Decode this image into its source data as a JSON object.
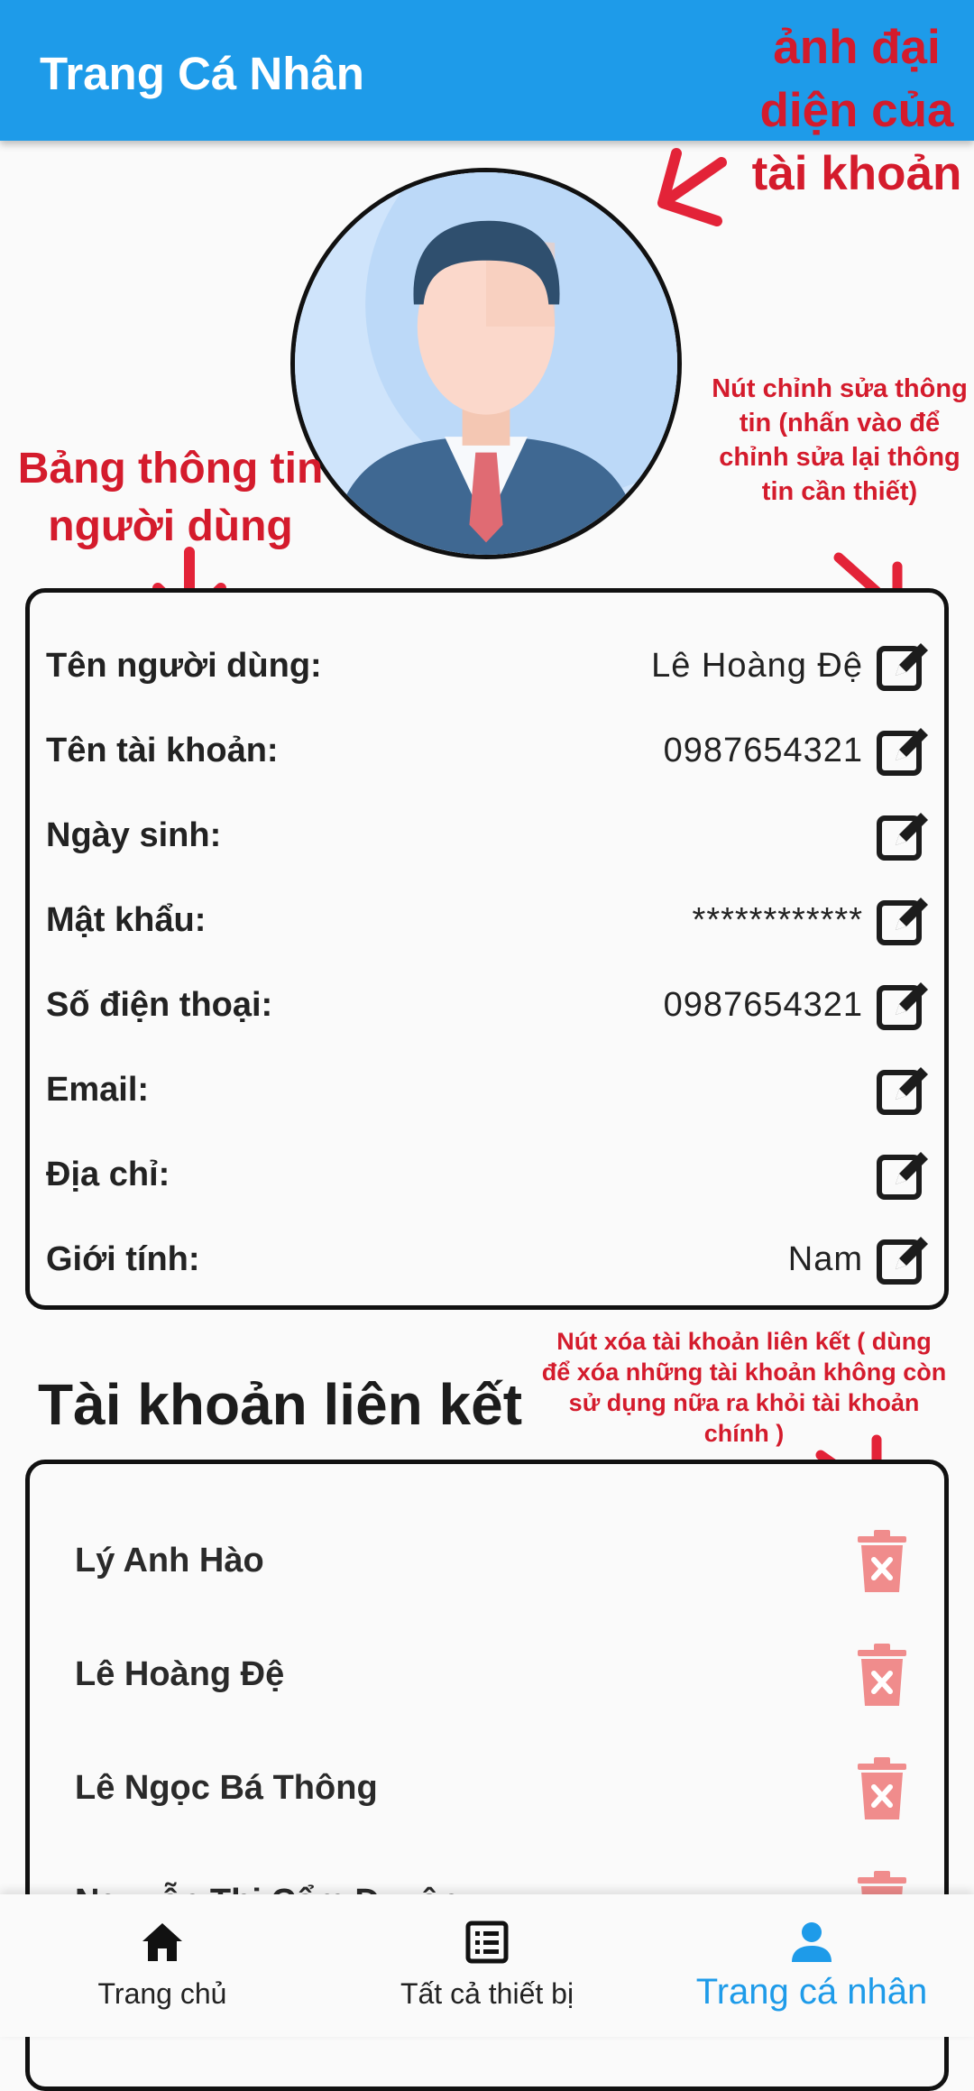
{
  "app_bar": {
    "title": "Trang Cá Nhân"
  },
  "annotations": {
    "avatar": "ảnh đại diện của tài khoản",
    "table": "Bảng thông tin người dùng",
    "edit": "Nút chỉnh sửa thông tin (nhấn vào để chỉnh sửa lại thông tin cần thiết)",
    "delete": "Nút xóa tài khoản liên kết ( dùng để xóa những tài khoản không còn sử dụng nữa ra khỏi tài khoản chính )"
  },
  "profile": {
    "fields": [
      {
        "label": "Tên người dùng:",
        "value": "Lê Hoàng Đệ"
      },
      {
        "label": "Tên tài khoản:",
        "value": "0987654321"
      },
      {
        "label": "Ngày sinh:",
        "value": ""
      },
      {
        "label": "Mật khẩu:",
        "value": "************"
      },
      {
        "label": "Số điện thoại:",
        "value": "0987654321"
      },
      {
        "label": "Email:",
        "value": ""
      },
      {
        "label": "Địa chỉ:",
        "value": ""
      },
      {
        "label": "Giới tính:",
        "value": "Nam"
      }
    ]
  },
  "linked": {
    "title": "Tài khoản liên kết",
    "accounts": [
      "Lý Anh Hào",
      "Lê Hoàng Đệ",
      "Lê Ngọc Bá Thông",
      "Nguyễn Thị Cẩm Duyên"
    ]
  },
  "bottom_nav": {
    "items": [
      {
        "label": "Trang chủ",
        "icon": "home-icon"
      },
      {
        "label": "Tất cả thiết bị",
        "icon": "list-icon"
      },
      {
        "label": "Trang cá nhân",
        "icon": "person-icon"
      }
    ],
    "active_index": 2
  },
  "colors": {
    "primary": "#1e9be9",
    "annotation": "#d41b2c",
    "trash": "#f08c8c"
  }
}
